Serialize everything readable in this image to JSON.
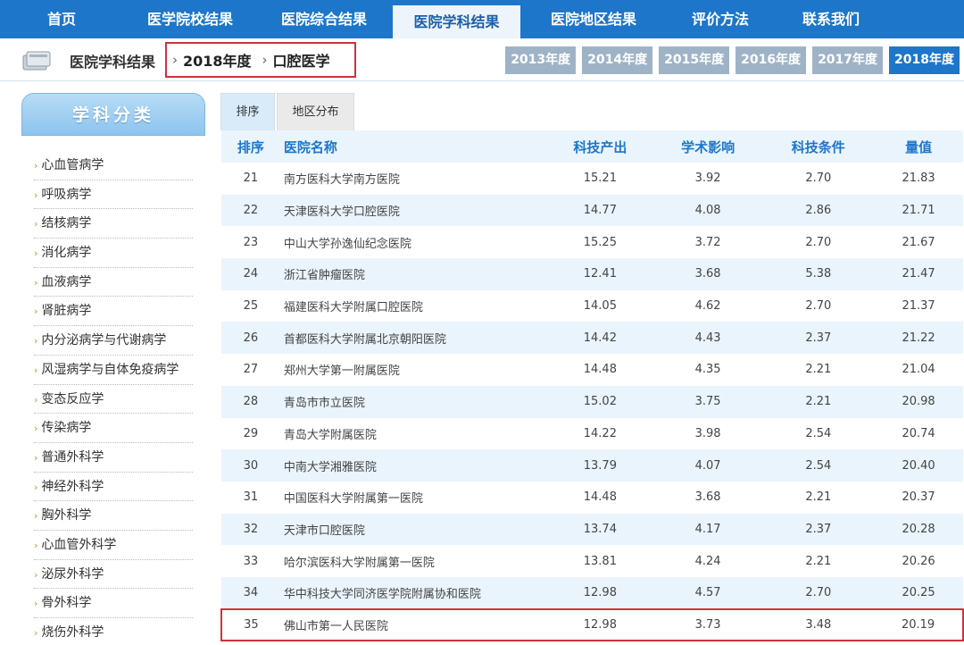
{
  "nav": {
    "items": [
      "首页",
      "医学院校结果",
      "医院综合结果",
      "医院学科结果",
      "医院地区结果",
      "评价方法",
      "联系我们"
    ],
    "active_index": 3
  },
  "breadcrumb": {
    "root": "医院学科结果",
    "year": "2018年度",
    "subject": "口腔医学",
    "separator": "›"
  },
  "years": [
    "2013年度",
    "2014年度",
    "2015年度",
    "2016年度",
    "2017年度",
    "2018年度"
  ],
  "sidebar": {
    "title": "学科分类",
    "items": [
      "心血管病学",
      "呼吸病学",
      "结核病学",
      "消化病学",
      "血液病学",
      "肾脏病学",
      "内分泌病学与代谢病学",
      "风湿病学与自体免疫病学",
      "变态反应学",
      "传染病学",
      "普通外科学",
      "神经外科学",
      "胸外科学",
      "心血管外科学",
      "泌尿外科学",
      "骨外科学",
      "烧伤外科学"
    ]
  },
  "tabs": [
    "排序",
    "地区分布"
  ],
  "table": {
    "headers": [
      "排序",
      "医院名称",
      "科技产出",
      "学术影响",
      "科技条件",
      "量值"
    ],
    "rows": [
      [
        "21",
        "南方医科大学南方医院",
        "15.21",
        "3.92",
        "2.70",
        "21.83"
      ],
      [
        "22",
        "天津医科大学口腔医院",
        "14.77",
        "4.08",
        "2.86",
        "21.71"
      ],
      [
        "23",
        "中山大学孙逸仙纪念医院",
        "15.25",
        "3.72",
        "2.70",
        "21.67"
      ],
      [
        "24",
        "浙江省肿瘤医院",
        "12.41",
        "3.68",
        "5.38",
        "21.47"
      ],
      [
        "25",
        "福建医科大学附属口腔医院",
        "14.05",
        "4.62",
        "2.70",
        "21.37"
      ],
      [
        "26",
        "首都医科大学附属北京朝阳医院",
        "14.42",
        "4.43",
        "2.37",
        "21.22"
      ],
      [
        "27",
        "郑州大学第一附属医院",
        "14.48",
        "4.35",
        "2.21",
        "21.04"
      ],
      [
        "28",
        "青岛市市立医院",
        "15.02",
        "3.75",
        "2.21",
        "20.98"
      ],
      [
        "29",
        "青岛大学附属医院",
        "14.22",
        "3.98",
        "2.54",
        "20.74"
      ],
      [
        "30",
        "中南大学湘雅医院",
        "13.79",
        "4.07",
        "2.54",
        "20.40"
      ],
      [
        "31",
        "中国医科大学附属第一医院",
        "14.48",
        "3.68",
        "2.21",
        "20.37"
      ],
      [
        "32",
        "天津市口腔医院",
        "13.74",
        "4.17",
        "2.37",
        "20.28"
      ],
      [
        "33",
        "哈尔滨医科大学附属第一医院",
        "13.81",
        "4.24",
        "2.21",
        "20.26"
      ],
      [
        "34",
        "华中科技大学同济医学院附属协和医院",
        "12.98",
        "4.57",
        "2.70",
        "20.25"
      ],
      [
        "35",
        "佛山市第一人民医院",
        "12.98",
        "3.73",
        "3.48",
        "20.19"
      ]
    ],
    "highlight_row": 14
  },
  "colors": {
    "nav_bg": "#1d76c9",
    "highlight_border": "#d0323b",
    "header_text": "#1d76c9",
    "row_alt": "#eaf4fc",
    "year_inactive": "#9fb3c7"
  }
}
